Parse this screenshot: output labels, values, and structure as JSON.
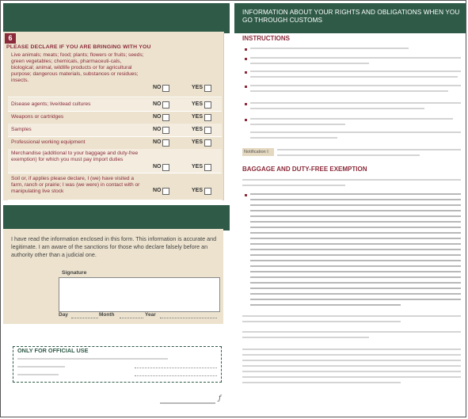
{
  "right_header": {
    "title": "INFORMATION ABOUT YOUR RIGHTS AND OBLIGATIONS WHEN YOU GO THROUGH CUSTOMS"
  },
  "section6": {
    "number": "6",
    "title": "PLEASE DECLARE IF YOU ARE BRINGING WITH YOU",
    "rows": [
      {
        "label": "Live animals; meats; food; plants; flowers or fruits; seeds; green vegetables; chemicals, pharmaceuti-cals, biological; animal, wildlife products or for agricultural purpose; dangerous materials, substances or residues; insects.",
        "no": "NO",
        "yes": "YES"
      },
      {
        "label": "Disease agents; live/dead cultures",
        "no": "NO",
        "yes": "YES"
      },
      {
        "label": "Weapons or cartridges",
        "no": "NO",
        "yes": "YES"
      },
      {
        "label": "Samples",
        "no": "NO",
        "yes": "YES"
      },
      {
        "label": "Professional working equipment",
        "no": "NO",
        "yes": "YES"
      },
      {
        "label": "Merchandise (additional to your baggage and duty-free exemption) for which you must pay import duties",
        "no": "NO",
        "yes": "YES"
      },
      {
        "label": "Soil or, if applies please declare, I (we) have visited a farm, ranch or prairie; I was (we were) in contact with or manipulating live stock",
        "no": "NO",
        "yes": "YES"
      }
    ]
  },
  "declaration": {
    "text": "I have read the information enclosed in this form. This information is accurate and legitimate. I am aware of the sanctions for those who declare falsely before an authority other than a judicial one.",
    "signature_label": "Signature",
    "day_label": "Day",
    "month_label": "Month",
    "year_label": "Year"
  },
  "official": {
    "title": "ONLY FOR OFFICIAL USE"
  },
  "right": {
    "instructions_title": "INSTRUCTIONS",
    "notification_label": "Notification I",
    "baggage_title": "BAGGAGE AND DUTY-FREE EXEMPTION"
  },
  "colors": {
    "green": "#2e5a47",
    "maroon": "#8b2a3a",
    "beige": "#ece2ce"
  }
}
